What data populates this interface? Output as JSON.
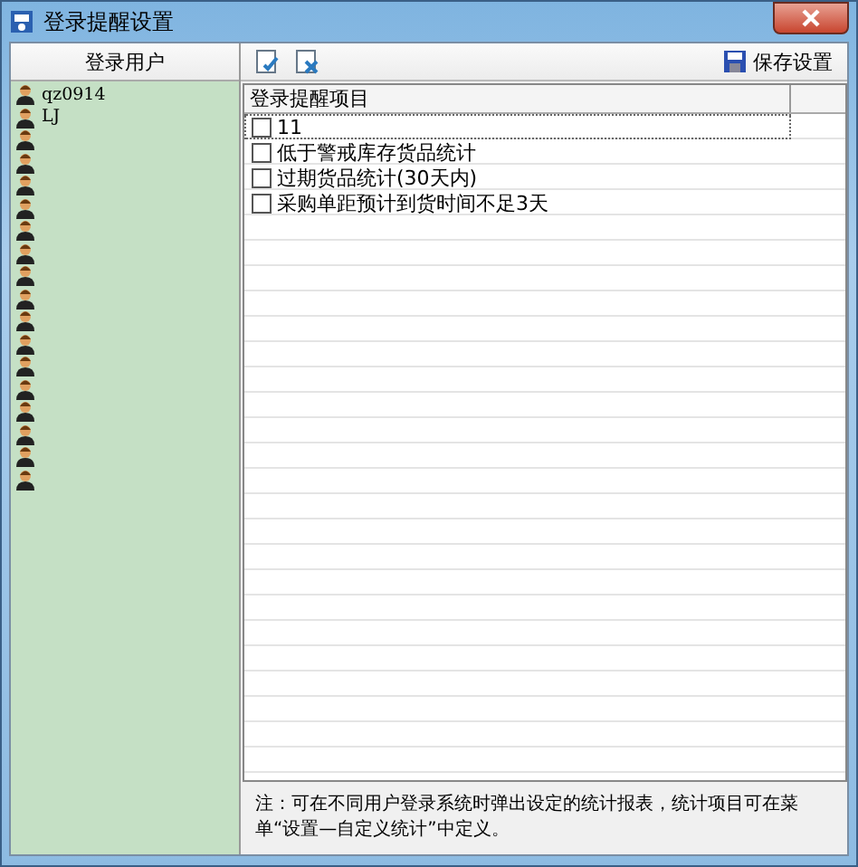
{
  "window": {
    "title": "登录提醒设置"
  },
  "users_header": "登录用户",
  "users": [
    {
      "kind": "named",
      "name": "qz0914"
    },
    {
      "kind": "named",
      "name": "LJ"
    },
    {
      "kind": "hidden"
    },
    {
      "kind": "hidden"
    },
    {
      "kind": "hidden"
    },
    {
      "kind": "hidden"
    },
    {
      "kind": "hidden"
    },
    {
      "kind": "hidden"
    },
    {
      "kind": "hidden"
    },
    {
      "kind": "hidden"
    },
    {
      "kind": "hidden"
    },
    {
      "kind": "hidden"
    },
    {
      "kind": "hidden"
    },
    {
      "kind": "hidden"
    },
    {
      "kind": "hidden"
    },
    {
      "kind": "hidden"
    },
    {
      "kind": "hidden"
    },
    {
      "kind": "hidden"
    }
  ],
  "toolbar": {
    "save_label": "保存设置"
  },
  "table": {
    "columns": [
      "登录提醒项目"
    ],
    "rows": [
      {
        "label": "11",
        "checked": false,
        "selected": true
      },
      {
        "label": "低于警戒库存货品统计",
        "checked": false,
        "selected": false
      },
      {
        "label": "过期货品统计(30天内)",
        "checked": false,
        "selected": false
      },
      {
        "label": "采购单距预计到货时间不足3天",
        "checked": false,
        "selected": false
      }
    ]
  },
  "note": "注：可在不同用户登录系统时弹出设定的统计报表，统计项目可在菜单“设置—自定义统计”中定义。"
}
